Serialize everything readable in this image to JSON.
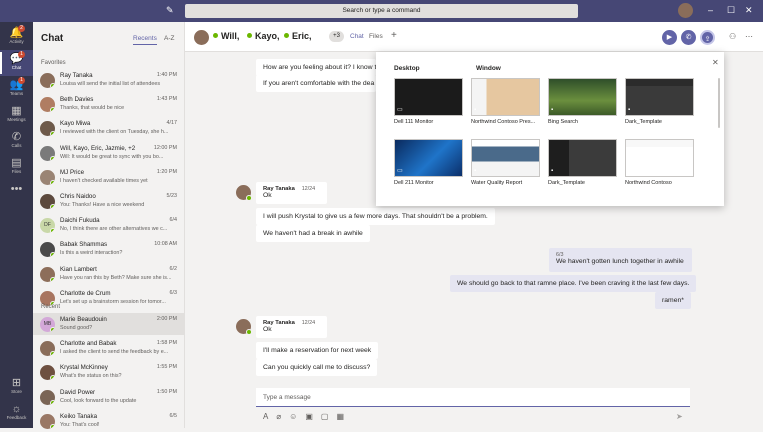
{
  "top": {
    "search_placeholder": "Search or type a command"
  },
  "rail": [
    {
      "label": "Activity",
      "icon": "bell-icon",
      "glyph": "🔔",
      "badge": "2"
    },
    {
      "label": "Chat",
      "icon": "chat-icon",
      "glyph": "💬",
      "badge": "1"
    },
    {
      "label": "Teams",
      "icon": "teams-icon",
      "glyph": "👥",
      "badge": "1"
    },
    {
      "label": "Meetings",
      "icon": "calendar-icon",
      "glyph": "▦",
      "badge": ""
    },
    {
      "label": "Calls",
      "icon": "phone-icon",
      "glyph": "✆",
      "badge": ""
    },
    {
      "label": "Files",
      "icon": "file-icon",
      "glyph": "▤",
      "badge": ""
    },
    {
      "label": "",
      "icon": "more-icon",
      "glyph": "•••",
      "badge": ""
    }
  ],
  "rail_bottom": [
    {
      "label": "Store",
      "icon": "store-icon",
      "glyph": "⊞"
    },
    {
      "label": "Feedback",
      "icon": "feedback-icon",
      "glyph": "☼"
    }
  ],
  "list": {
    "title": "Chat",
    "tab_recents": "Recents",
    "tab_az": "A-Z",
    "favorites_label": "Favorites",
    "recent_label": "Recent",
    "favorites": [
      {
        "name": "Ray Tanaka",
        "time": "1:40 PM",
        "preview": "Louisa will send the initial list of attendees",
        "color": "#8a6d5a"
      },
      {
        "name": "Beth Davies",
        "time": "1:43 PM",
        "preview": "Thanks, that would be nice",
        "color": "#b07d62"
      },
      {
        "name": "Kayo Miwa",
        "time": "4/17",
        "preview": "I reviewed with the client on Tuesday, she h...",
        "color": "#6e5a4a"
      },
      {
        "name": "Will, Kayo, Eric, Jazmie, +2",
        "time": "12:00 PM",
        "preview": "Will: It would be great to sync with you bo...",
        "color": "#7a7a7a"
      },
      {
        "name": "MJ Price",
        "time": "1:20 PM",
        "preview": "I haven't checked available times yet",
        "color": "#9a8474"
      },
      {
        "name": "Chris Naidoo",
        "time": "5/23",
        "preview": "You: Thanks! Have a nice weekend",
        "color": "#5d4a3e"
      },
      {
        "name": "Daichi Fukuda",
        "time": "6/4",
        "preview": "No, I think there are other alternatives we c...",
        "color": "#c9d8a8",
        "initials": "DF"
      },
      {
        "name": "Babak Shammas",
        "time": "10:08 AM",
        "preview": "Is this a weird interaction?",
        "color": "#4a4a4a"
      },
      {
        "name": "Kian Lambert",
        "time": "6/2",
        "preview": "Have you ran this by Beth? Make sure she is...",
        "color": "#8d6e5a"
      },
      {
        "name": "Charlotte de Crum",
        "time": "6/3",
        "preview": "Let's set up a brainstorm session for tomor...",
        "color": "#a87560"
      }
    ],
    "recent": [
      {
        "name": "Marie Beaudouin",
        "time": "2:00 PM",
        "preview": "Sound good?",
        "color": "#d3a8d8",
        "initials": "MB",
        "selected": true
      },
      {
        "name": "Charlotte and Babak",
        "time": "1:58 PM",
        "preview": "I asked the client to send the feedback by e...",
        "color": "#8a6d5a"
      },
      {
        "name": "Krystal McKinney",
        "time": "1:55 PM",
        "preview": "What's the status on this?",
        "color": "#6e5040"
      },
      {
        "name": "David Power",
        "time": "1:50 PM",
        "preview": "Cool, look forward to the update",
        "color": "#7a6555"
      },
      {
        "name": "Keiko Tanaka",
        "time": "6/5",
        "preview": "You: That's cool!",
        "color": "#9a7865"
      }
    ]
  },
  "header": {
    "participants_prefix": "",
    "p1": "Will,",
    "p2": "Kayo,",
    "p3": "Eric,",
    "more_count": "+3",
    "tab_chat": "Chat",
    "tab_files": "Files",
    "add_tab": "+"
  },
  "messages": {
    "top1": "How are you feeling about it? I know t",
    "top2": "If you aren't comfortable with the dea",
    "ray1_name": "Ray Tanaka",
    "ray1_time": "12/24",
    "ray1_a": "Ok",
    "ray1_b": "I will push Krystal to give us a few more days. That shouldn't be a problem.",
    "ray1_c": "We haven't had a break in awhile",
    "me_time": "6/3",
    "me_a": "We haven't gotten lunch together in awhile",
    "me_b": "We should go back to that ramne place. I've been craving it the last few days.",
    "me_c": "ramen*",
    "ray2_name": "Ray Tanaka",
    "ray2_time": "12/24",
    "ray2_a": "Ok",
    "ray2_b": "I'll make a reservation for next week",
    "ray2_c": "Can you quickly call me to discuss?"
  },
  "compose": {
    "placeholder": "Type a message"
  },
  "share": {
    "desktop_label": "Desktop",
    "window_label": "Window",
    "items": [
      {
        "label": "Dell 111 Monitor",
        "kind": "desktop",
        "theme": "dark"
      },
      {
        "label": "Northwind Contoso Pres...",
        "kind": "window",
        "theme": "ppt"
      },
      {
        "label": "Bing Search",
        "kind": "window",
        "theme": "bing"
      },
      {
        "label": "Dark_Template",
        "kind": "window",
        "theme": "darkdoc"
      },
      {
        "label": "Dell 211 Monitor",
        "kind": "desktop",
        "theme": "win10"
      },
      {
        "label": "Water Quality Report",
        "kind": "window",
        "theme": "report"
      },
      {
        "label": "Dark_Template",
        "kind": "window",
        "theme": "darkdoc2"
      },
      {
        "label": "Northwind Contoso",
        "kind": "window",
        "theme": "doc"
      }
    ]
  }
}
